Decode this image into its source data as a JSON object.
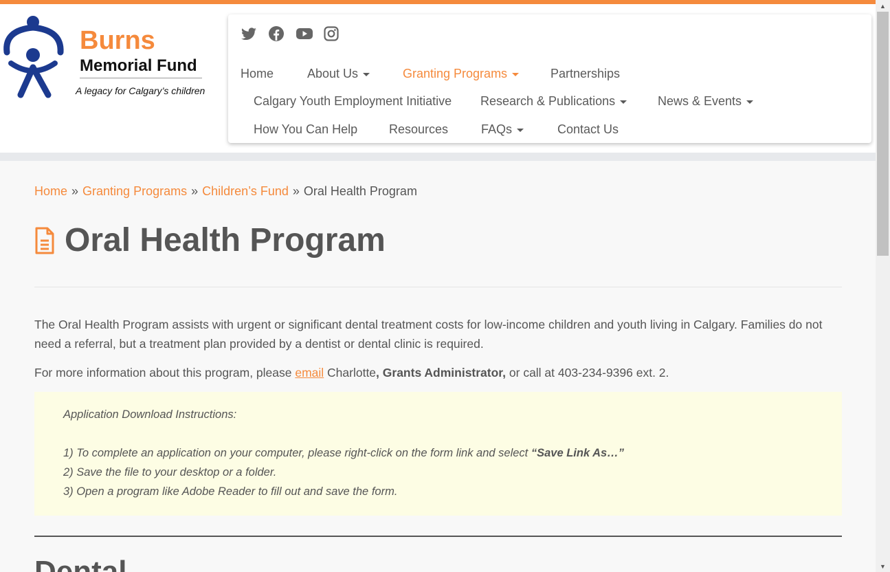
{
  "colors": {
    "accent": "#f58a3c",
    "text": "#555555",
    "note_bg": "#fdfde4",
    "band": "#e7e9ec"
  },
  "logo": {
    "name_line1": "Burns",
    "name_line2": "Memorial Fund",
    "tagline": "A legacy for Calgary’s children"
  },
  "social": [
    "twitter-icon",
    "facebook-icon",
    "youtube-icon",
    "instagram-icon"
  ],
  "nav": {
    "row1": [
      {
        "label": "Home",
        "dropdown": false
      },
      {
        "label": "About Us",
        "dropdown": true
      },
      {
        "label": "Granting Programs",
        "dropdown": true,
        "active": true
      },
      {
        "label": "Partnerships",
        "dropdown": false
      }
    ],
    "row2": [
      {
        "label": "Calgary Youth Employment Initiative",
        "dropdown": false
      },
      {
        "label": "Research & Publications",
        "dropdown": true
      },
      {
        "label": "News & Events",
        "dropdown": true
      }
    ],
    "row3": [
      {
        "label": "How You Can Help",
        "dropdown": false
      },
      {
        "label": "Resources",
        "dropdown": false
      },
      {
        "label": "FAQs",
        "dropdown": true
      },
      {
        "label": "Contact Us",
        "dropdown": false
      }
    ]
  },
  "breadcrumb": {
    "home": "Home",
    "separator": "»",
    "granting": "Granting Programs",
    "childrens": "Children’s Fund",
    "current": "Oral Health Program"
  },
  "page": {
    "title": "Oral Health Program",
    "intro": "The Oral Health Program assists with urgent or significant dental treatment costs for low-income children and youth living in Calgary. Families do not need a referral, but a treatment plan provided by a dentist or dental clinic is required.",
    "contact_prefix": "For more information about this program, please ",
    "contact_link": "email",
    "contact_name": " Charlotte",
    "contact_role": ", Grants Administrator,",
    "contact_suffix": " or call at 403-234-9396 ext. 2.",
    "note": {
      "heading": "Application Download Instructions:",
      "step1": "1) To complete an application on your computer, please right-click on the form link and select ",
      "step1_bold": "“Save Link As…”",
      "step2": "2) Save the file to your desktop or a folder.",
      "step3": "3) Open a program like Adobe Reader to fill out and save the form."
    },
    "section_heading": "Dental"
  }
}
